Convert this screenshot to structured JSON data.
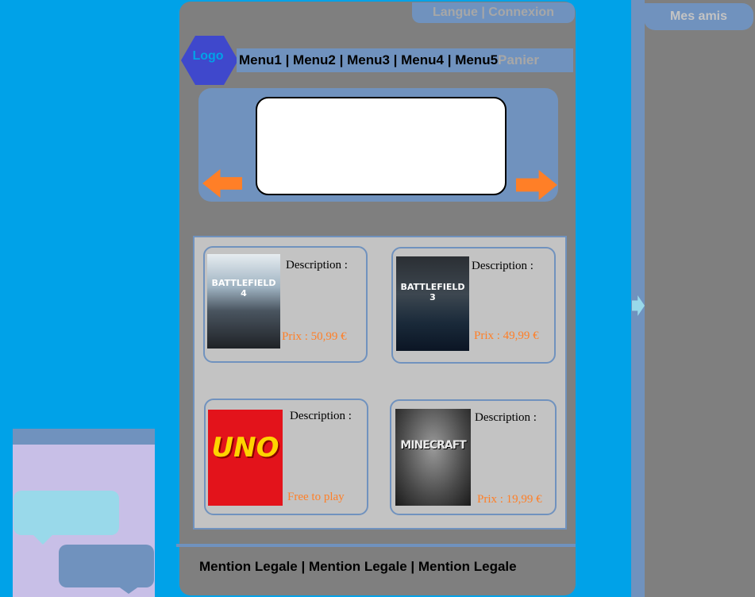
{
  "header": {
    "top_links": {
      "language": "Langue",
      "separator": " | ",
      "login": "Connexion"
    },
    "logo_label": "Logo",
    "nav": {
      "items": [
        "Menu1",
        "Menu2",
        "Menu3",
        "Menu4",
        "Menu5"
      ],
      "separator": " | ",
      "cart": "Panier"
    }
  },
  "slider": {
    "prev_icon": "arrow-left-icon",
    "next_icon": "arrow-right-icon"
  },
  "products": [
    {
      "title_art": "BATTLEFIELD 4",
      "description_label": "Description :",
      "price": "Prix : 50,99 €"
    },
    {
      "title_art": "BATTLEFIELD 3",
      "description_label": "Description :",
      "price": "Prix : 49,99 €"
    },
    {
      "title_art": "UNO",
      "description_label": "Description :",
      "price": "Free to play"
    },
    {
      "title_art": "MINECRAFT",
      "description_label": "Description :",
      "price": "Prix : 19,99 €"
    }
  ],
  "footer": {
    "links": [
      "Mention Legale",
      "Mention Legale",
      "Mention Legale"
    ],
    "separator": " | "
  },
  "friends": {
    "title": "Mes amis",
    "toggle_icon": "arrow-right-icon"
  },
  "colors": {
    "background": "#00a2e8",
    "panel": "#7f7f7f",
    "accent": "#7092be",
    "arrow": "#ff7f27",
    "price": "#ff7f27",
    "logo": "#3f48cc",
    "chat_bg": "#c8bfe7"
  }
}
